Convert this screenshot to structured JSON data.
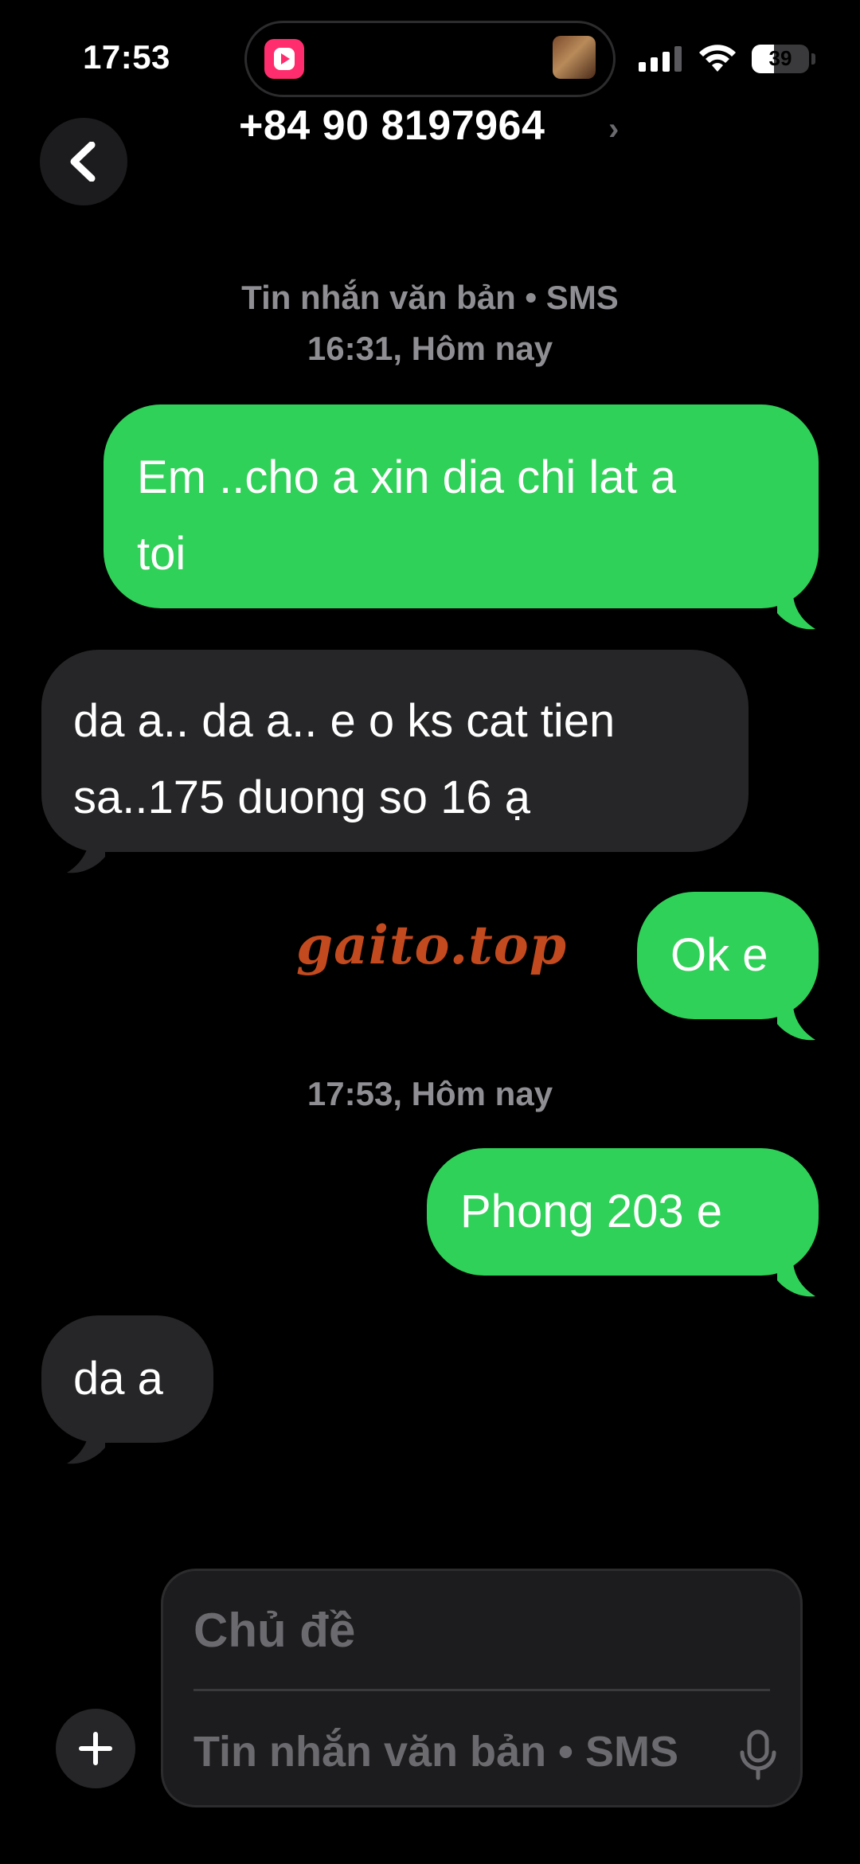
{
  "status_bar": {
    "time": "17:53",
    "battery_level": "39",
    "battery_fraction": 0.39,
    "signal_bars_active": 3,
    "signal_bars_total": 4
  },
  "header": {
    "contact": "+84 90 8197964",
    "chevron": "›"
  },
  "conversation": {
    "meta_1": {
      "service": "Tin nhắn văn bản • SMS",
      "timestamp": "16:31, Hôm nay"
    },
    "meta_2": {
      "timestamp": "17:53, Hôm nay"
    },
    "messages": [
      {
        "direction": "outgoing",
        "line1": "Em ..cho a xin dia chi lat a",
        "line2": "toi"
      },
      {
        "direction": "incoming",
        "line1": "da a.. da a.. e o ks cat tien",
        "line2": "sa..175 duong so 16 ạ"
      },
      {
        "direction": "outgoing",
        "text": "Ok e"
      },
      {
        "direction": "outgoing",
        "text": "Phong 203 e"
      },
      {
        "direction": "incoming",
        "text": "da a"
      }
    ]
  },
  "watermark": "gaito.top",
  "composer": {
    "subject_placeholder": "Chủ đề",
    "message_placeholder": "Tin nhắn văn bản • SMS",
    "add_icon": "plus-icon",
    "mic_icon": "microphone-icon"
  },
  "colors": {
    "background": "#000000",
    "outgoing_bubble": "#30d158",
    "incoming_bubble": "#262628",
    "meta_text": "#8e8e93",
    "watermark": "#c24a1e"
  }
}
